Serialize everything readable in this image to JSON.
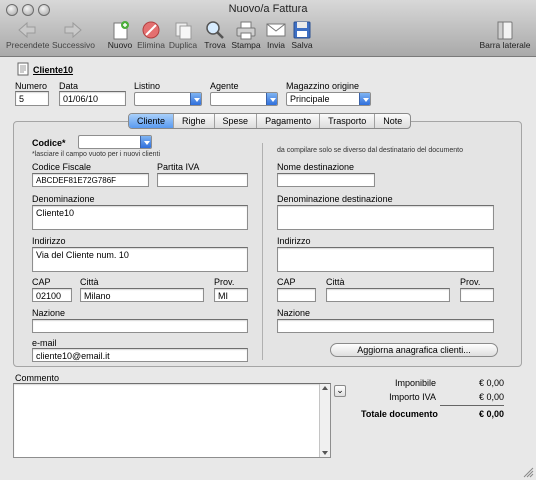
{
  "window": {
    "title": "Nuovo/a Fattura"
  },
  "toolbar": {
    "prev": "Precendete",
    "next": "Successivo",
    "new": "Nuovo",
    "delete": "Elimina",
    "duplicate": "Duplica",
    "find": "Trova",
    "print": "Stampa",
    "send": "Invia",
    "save": "Salva",
    "sidebar": "Barra laterale"
  },
  "header": {
    "customer_title": "Cliente10",
    "numero_label": "Numero",
    "numero_value": "5",
    "data_label": "Data",
    "data_value": "01/06/10",
    "listino_label": "Listino",
    "listino_value": "",
    "agente_label": "Agente",
    "agente_value": "",
    "magazzino_label": "Magazzino origine",
    "magazzino_value": "Principale"
  },
  "tabs": [
    "Cliente",
    "Righe",
    "Spese",
    "Pagamento",
    "Trasporto",
    "Note"
  ],
  "cliente": {
    "codice_label": "Codice*",
    "codice_hint": "*lasciare il campo vuoto per i nuovi clienti",
    "cf_label": "Codice Fiscale",
    "cf_value": "ABCDEF81E72G786F",
    "piva_label": "Partita IVA",
    "piva_value": "",
    "denominazione_label": "Denominazione",
    "denominazione_value": "Cliente10",
    "indirizzo_label": "Indirizzo",
    "indirizzo_value": "Via del Cliente num. 10",
    "cap_label": "CAP",
    "cap_value": "02100",
    "citta_label": "Città",
    "citta_value": "Milano",
    "prov_label": "Prov.",
    "prov_value": "MI",
    "nazione_label": "Nazione",
    "nazione_value": "",
    "email_label": "e-mail",
    "email_value": "cliente10@email.it"
  },
  "destinazione": {
    "note": "da compilare solo se diverso dal destinatario del documento",
    "nome_label": "Nome destinazione",
    "denominazione_label": "Denominazione destinazione",
    "indirizzo_label": "Indirizzo",
    "cap_label": "CAP",
    "citta_label": "Città",
    "prov_label": "Prov.",
    "nazione_label": "Nazione",
    "update_button": "Aggiorna anagrafica clienti..."
  },
  "commento": {
    "label": "Commento",
    "value": ""
  },
  "totali": {
    "imponibile_label": "Imponibile",
    "imponibile_value": "€ 0,00",
    "iva_label": "Importo IVA",
    "iva_value": "€ 0,00",
    "totale_label": "Totale documento",
    "totale_value": "€ 0,00"
  }
}
